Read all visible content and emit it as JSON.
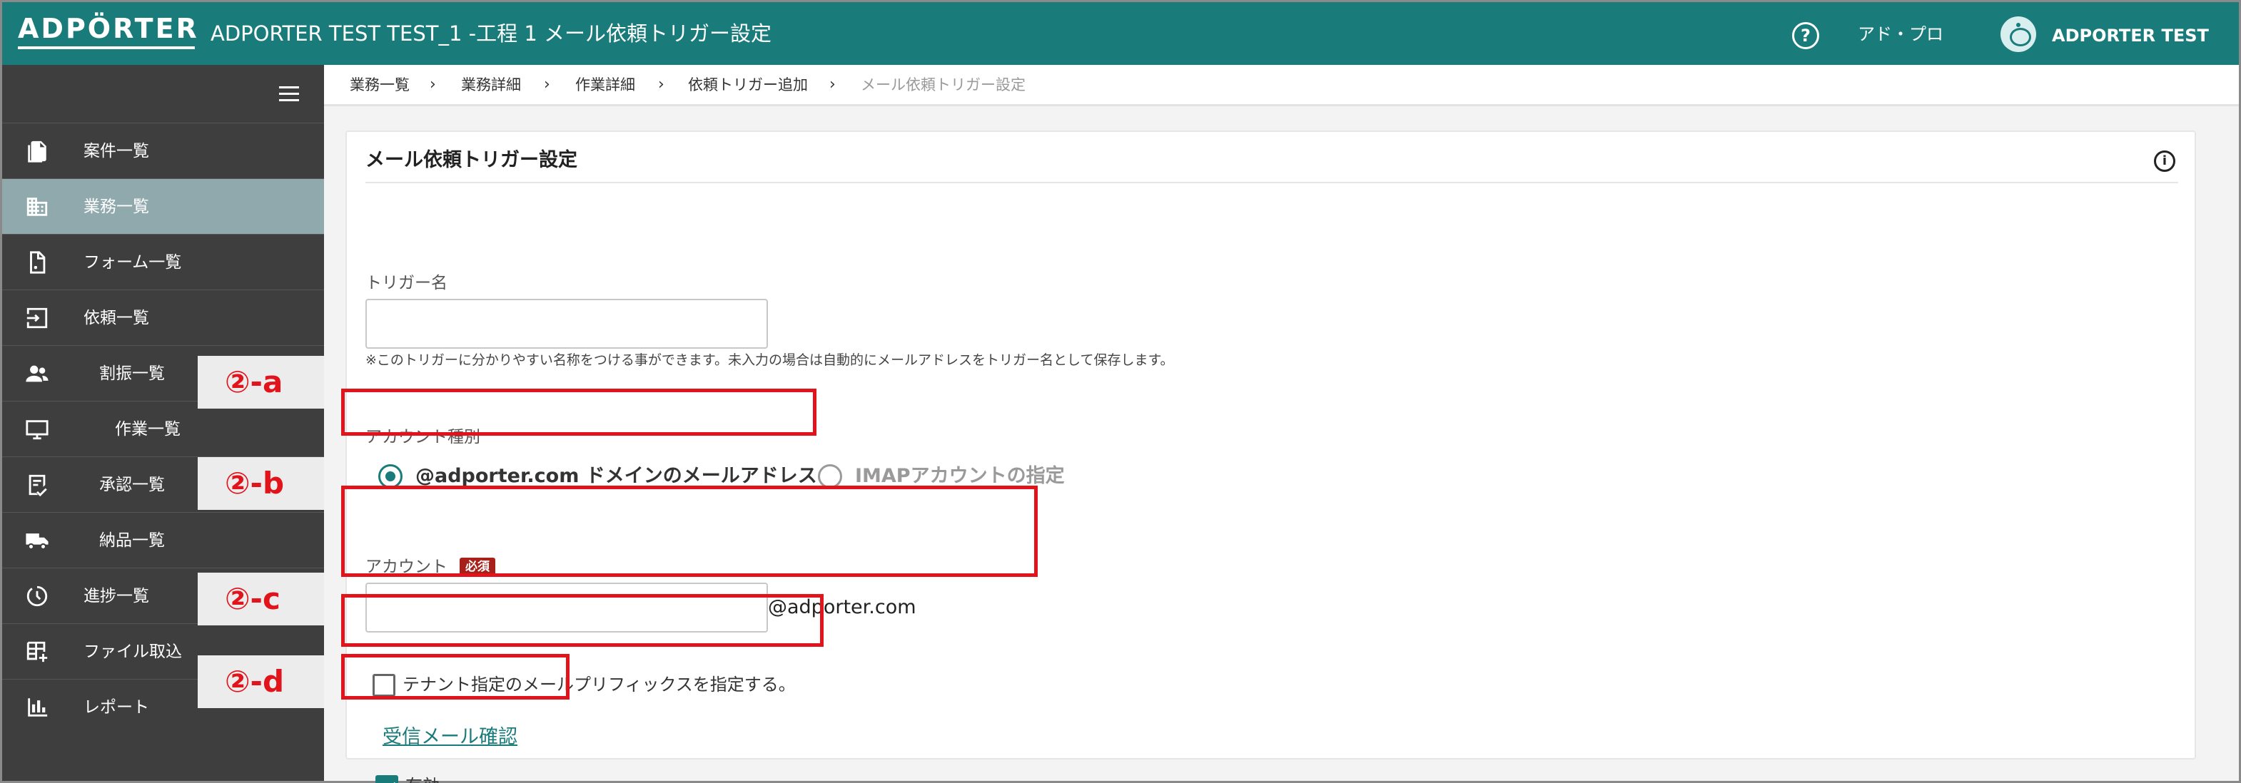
{
  "header": {
    "logo": "ADPÖRTER",
    "title": "ADPORTER TEST TEST_1 -工程 1 メール依頼トリガー設定",
    "help_icon": "?",
    "org_name": "アド・プロ",
    "user_name": "ADPORTER TEST"
  },
  "sidebar": {
    "items": [
      {
        "label": "案件一覧",
        "icon": "document-icon"
      },
      {
        "label": "業務一覧",
        "icon": "building-icon"
      },
      {
        "label": "フォーム一覧",
        "icon": "form-icon"
      },
      {
        "label": "依頼一覧",
        "icon": "inbox-icon"
      },
      {
        "label": "割振一覧",
        "icon": "people-icon"
      },
      {
        "label": "作業一覧",
        "icon": "monitor-icon"
      },
      {
        "label": "承認一覧",
        "icon": "approval-icon"
      },
      {
        "label": "納品一覧",
        "icon": "truck-icon"
      },
      {
        "label": "進捗一覧",
        "icon": "clock-icon"
      },
      {
        "label": "ファイル取込",
        "icon": "table-add-icon"
      },
      {
        "label": "レポート",
        "icon": "bar-chart-icon"
      }
    ]
  },
  "steps": {
    "a": "②-a",
    "b": "②-b",
    "c": "②-c",
    "d": "②-d"
  },
  "breadcrumb": [
    "業務一覧",
    "業務詳細",
    "作業詳細",
    "依頼トリガー追加",
    "メール依頼トリガー設定"
  ],
  "form": {
    "title": "メール依頼トリガー設定",
    "info_icon": "i",
    "trigger_name_label": "トリガー名",
    "trigger_name_value": "",
    "trigger_name_hint": "※このトリガーに分かりやすい名称をつける事ができます。未入力の場合は自動的にメールアドレスをトリガー名として保存します。",
    "account_type_label": "アカウント種別",
    "account_type_options": [
      "@adporter.com ドメインのメールアドレス",
      "IMAPアカウントの指定"
    ],
    "account_type_selected": "@adporter.com ドメインのメールアドレス",
    "account_label": "アカウント",
    "required_badge": "必須",
    "account_value": "",
    "account_suffix": "@adporter.com",
    "tenant_prefix_label": "テナント指定のメールプリフィックスを指定する。",
    "tenant_prefix_checked": false,
    "check_mail_link": "受信メール確認",
    "enabled_label": "有効",
    "enabled_checked": true
  },
  "colors": {
    "brand": "#1a7b7b",
    "sidebar": "#3e3e3e",
    "highlight": "#e0141a",
    "required": "#a8201a"
  }
}
